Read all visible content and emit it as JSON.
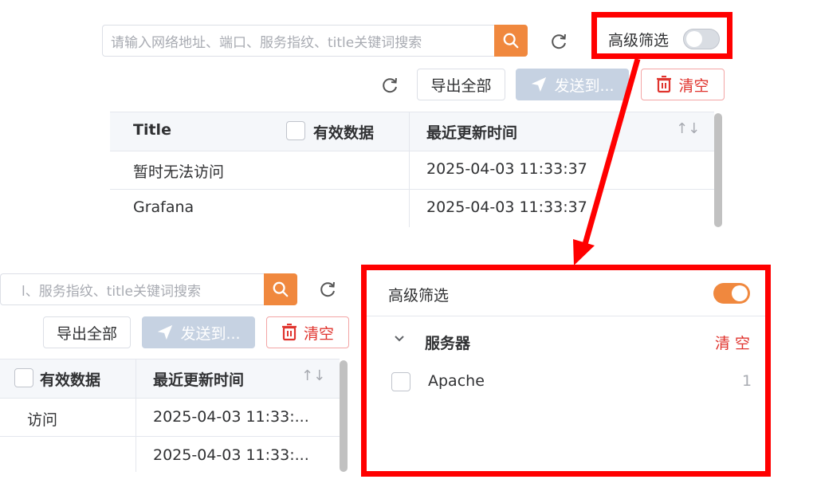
{
  "search": {
    "placeholder_full": "请输入网络地址、端口、服务指纹、title关键词搜索",
    "placeholder_cropped": "l、服务指纹、title关键词搜索"
  },
  "toolbar": {
    "export_label": "导出全部",
    "send_label": "发送到...",
    "clear_label": "清空"
  },
  "advanced_filter": {
    "label": "高级筛选",
    "enabled_top": false,
    "enabled_bottom": true
  },
  "table_top": {
    "columns": {
      "title": "Title",
      "valid_data": "有效数据",
      "updated": "最近更新时间"
    },
    "rows": [
      {
        "title": "暂时无法访问",
        "updated": "2025-04-03 11:33:37"
      },
      {
        "title": "Grafana",
        "updated": "2025-04-03 11:33:37"
      }
    ]
  },
  "table_bottom": {
    "columns": {
      "valid_data": "有效数据",
      "updated": "最近更新时间"
    },
    "rows": [
      {
        "title": "访问",
        "updated": "2025-04-03 11:33:..."
      },
      {
        "title": "",
        "updated": "2025-04-03 11:33:..."
      }
    ]
  },
  "filter_panel": {
    "title": "高级筛选",
    "group": {
      "label": "服务器",
      "clear": "清 空"
    },
    "options": [
      {
        "label": "Apache",
        "count": "1"
      }
    ]
  },
  "colors": {
    "accent": "#f0883e",
    "highlight": "#ff0000",
    "danger": "#e0342e",
    "disabled": "#c6d2e2"
  },
  "icons": [
    "search-icon",
    "refresh-icon",
    "send-icon",
    "trash-icon",
    "sort-icon",
    "chevron-down-icon"
  ]
}
